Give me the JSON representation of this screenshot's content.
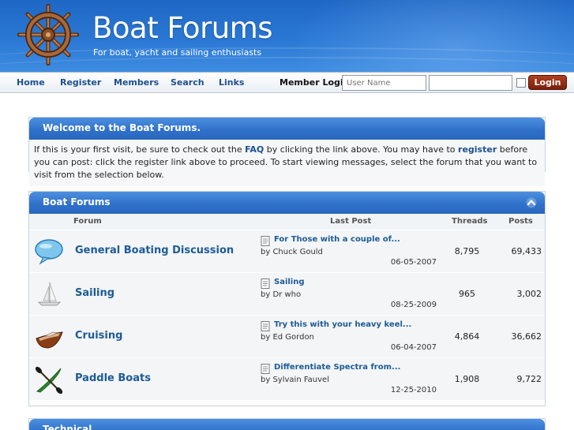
{
  "header": {
    "title": "Boat Forums",
    "tagline": "For boat, yacht and sailing enthusiasts"
  },
  "nav": {
    "links": [
      "Home",
      "Register",
      "Members",
      "Search",
      "Links"
    ],
    "login_label": "Member Login:",
    "username_placeholder": "User Name",
    "password_value": "",
    "login_button": "Login"
  },
  "welcome": {
    "title": "Welcome to the Boat Forums.",
    "text_1": "If this is your first visit, be sure to check out the ",
    "faq_link": "FAQ",
    "text_2": " by clicking the link above. You may have to ",
    "register_link": "register",
    "text_3": " before you can post: click the register link above to proceed. To start viewing messages, select the forum that you want to visit from the selection below."
  },
  "forums_panel": {
    "title": "Boat Forums",
    "columns": {
      "forum": "Forum",
      "last_post": "Last Post",
      "threads": "Threads",
      "posts": "Posts"
    },
    "rows": [
      {
        "icon": "speech-bubble-icon",
        "name": "General Boating Discussion",
        "last_post_title": "For Those with a couple of...",
        "by": "by Chuck Gould",
        "date": "06-05-2007",
        "threads": "8,795",
        "posts": "69,433"
      },
      {
        "icon": "sailboat-icon",
        "name": "Sailing",
        "last_post_title": "Sailing",
        "by": "by Dr who",
        "date": "08-25-2009",
        "threads": "965",
        "posts": "3,002"
      },
      {
        "icon": "cruiser-boat-icon",
        "name": "Cruising",
        "last_post_title": "Try this with your heavy keel...",
        "by": "by Ed Gordon",
        "date": "06-04-2007",
        "threads": "4,864",
        "posts": "36,662"
      },
      {
        "icon": "kayak-paddle-icon",
        "name": "Paddle Boats",
        "last_post_title": "Differentiate Spectra from...",
        "by": "by Sylvain Fauvel",
        "date": "12-25-2010",
        "threads": "1,908",
        "posts": "9,722"
      }
    ]
  },
  "technical_panel": {
    "title": "Technical"
  },
  "colors": {
    "header_blue": "#2a78d4",
    "link_blue": "#1d5b95",
    "login_button": "#8f2a12"
  }
}
